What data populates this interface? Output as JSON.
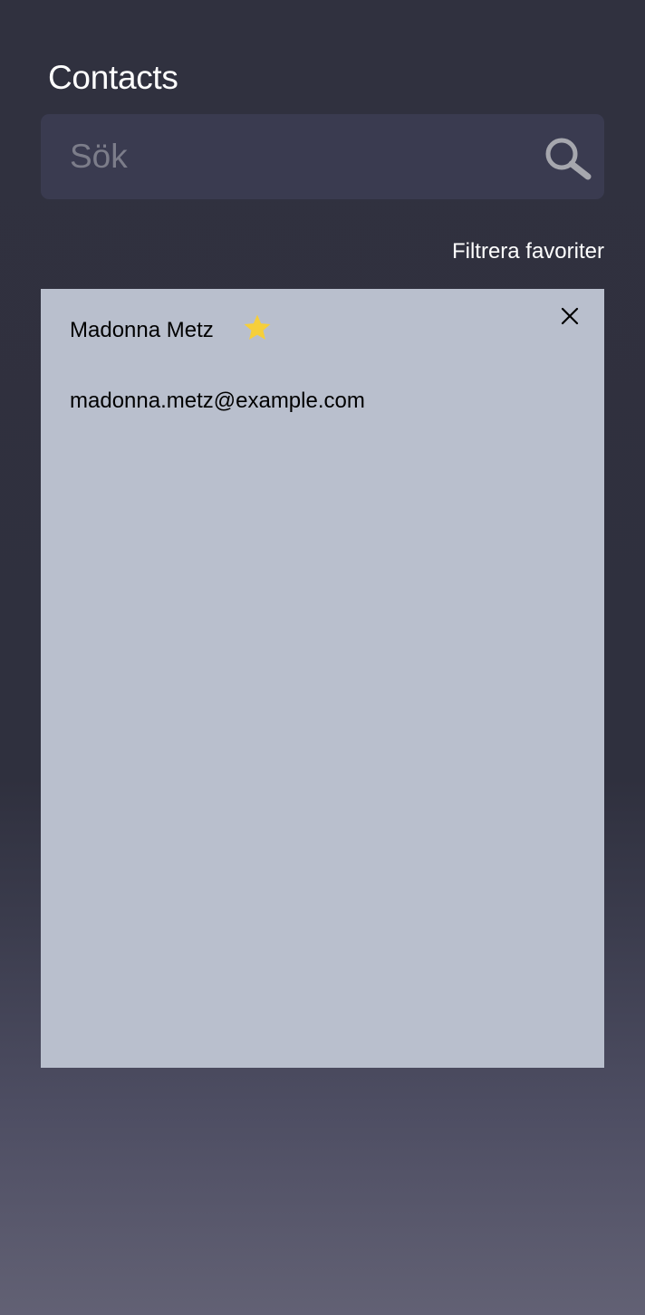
{
  "header": {
    "title": "Contacts"
  },
  "search": {
    "placeholder": "Sök",
    "value": "",
    "icon": "search-icon"
  },
  "filter": {
    "label": "Filtrera favoriter"
  },
  "contacts": [
    {
      "name": "Madonna Metz",
      "email": "madonna.metz@example.com",
      "favorite": true,
      "favorite_icon": "star-icon",
      "remove_icon": "close-icon"
    }
  ],
  "colors": {
    "background_top": "#30313f",
    "background_bottom": "#626174",
    "search_bg": "#3a3b50",
    "card_bg": "#b9bfcd",
    "star": "#f6cf3a"
  }
}
